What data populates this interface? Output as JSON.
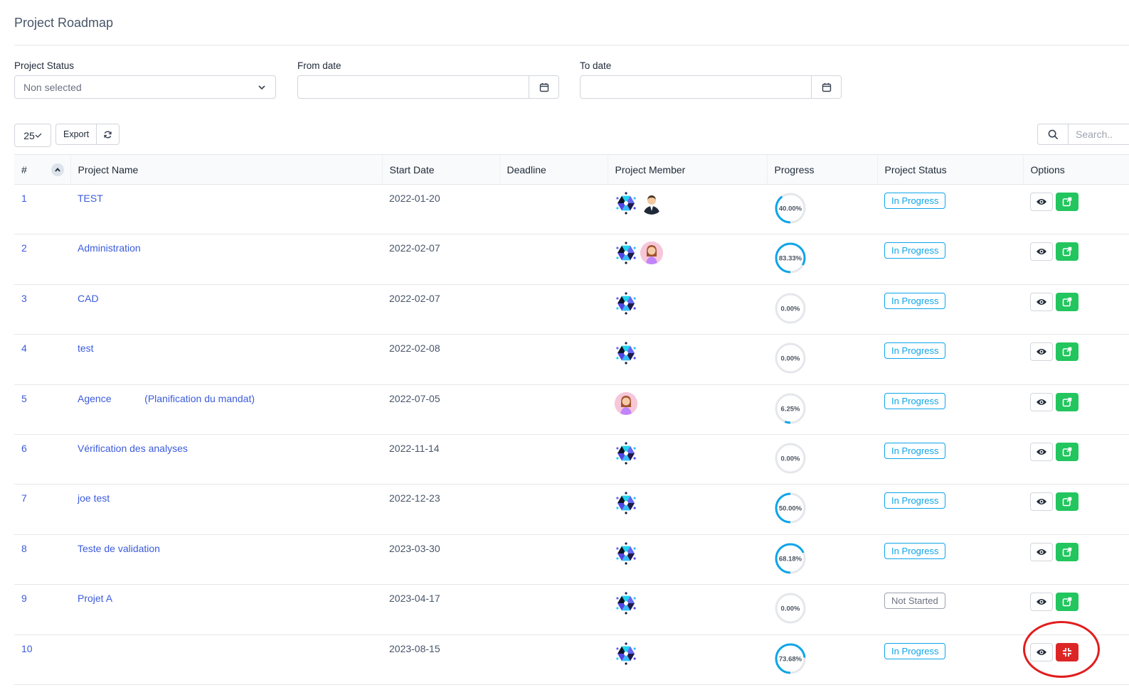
{
  "page": {
    "title": "Project Roadmap"
  },
  "filters": {
    "status_label": "Project Status",
    "status_placeholder": "Non selected",
    "from_label": "From date",
    "to_label": "To date"
  },
  "toolbar": {
    "page_length": "25",
    "export_label": "Export",
    "search_placeholder": "Search.."
  },
  "table": {
    "headers": [
      "#",
      "Project Name",
      "Start Date",
      "Deadline",
      "Project Member",
      "Progress",
      "Project Status",
      "Options"
    ],
    "rows": [
      {
        "num": "1",
        "name": "TEST",
        "start": "2022-01-20",
        "deadline": "",
        "members": [
          "logo",
          "man"
        ],
        "progress": 40.0,
        "progress_label": "40.00%",
        "status": "In Progress",
        "action": "edit"
      },
      {
        "num": "2",
        "name": "Administration",
        "start": "2022-02-07",
        "deadline": "",
        "members": [
          "logo",
          "woman"
        ],
        "progress": 83.33,
        "progress_label": "83.33%",
        "status": "In Progress",
        "action": "edit"
      },
      {
        "num": "3",
        "name": "CAD",
        "start": "2022-02-07",
        "deadline": "",
        "members": [
          "logo"
        ],
        "progress": 0,
        "progress_label": "0.00%",
        "status": "In Progress",
        "action": "edit"
      },
      {
        "num": "4",
        "name": "test",
        "start": "2022-02-08",
        "deadline": "",
        "members": [
          "logo"
        ],
        "progress": 0,
        "progress_label": "0.00%",
        "status": "In Progress",
        "action": "edit"
      },
      {
        "num": "5",
        "name": "Agence            (Planification du mandat)",
        "start": "2022-07-05",
        "deadline": "",
        "members": [
          "woman"
        ],
        "progress": 6.25,
        "progress_label": "6.25%",
        "status": "In Progress",
        "action": "edit"
      },
      {
        "num": "6",
        "name": "Vérification des analyses",
        "start": "2022-11-14",
        "deadline": "",
        "members": [
          "logo"
        ],
        "progress": 0,
        "progress_label": "0.00%",
        "status": "In Progress",
        "action": "edit"
      },
      {
        "num": "7",
        "name": "joe test",
        "start": "2022-12-23",
        "deadline": "",
        "members": [
          "logo"
        ],
        "progress": 50.0,
        "progress_label": "50.00%",
        "status": "In Progress",
        "action": "edit"
      },
      {
        "num": "8",
        "name": "Teste de validation",
        "start": "2023-03-30",
        "deadline": "",
        "members": [
          "logo"
        ],
        "progress": 68.18,
        "progress_label": "68.18%",
        "status": "In Progress",
        "action": "edit"
      },
      {
        "num": "9",
        "name": "Projet A",
        "start": "2023-04-17",
        "deadline": "",
        "members": [
          "logo"
        ],
        "progress": 0,
        "progress_label": "0.00%",
        "status": "Not Started",
        "action": "edit"
      },
      {
        "num": "10",
        "name": "",
        "start": "2023-08-15",
        "deadline": "",
        "members": [
          "logo"
        ],
        "progress": 73.68,
        "progress_label": "73.68%",
        "status": "In Progress",
        "action": "compress"
      }
    ]
  },
  "colors": {
    "link": "#3b5bdb",
    "status_in_progress": "#0ea5e9",
    "status_not_started": "#9ca3af",
    "progress_ring": "#0ea5e9",
    "edit_button": "#22c55e",
    "alt_button": "#dc2626",
    "annotation": "#e11d1d"
  },
  "icons": {
    "dropdown": "chevron-down-icon",
    "date_picker": "calendar-icon",
    "length_select": "check-icon",
    "reload": "refresh-icon",
    "search": "search-icon",
    "sort": "chevron-up-icon",
    "view": "eye-icon",
    "edit": "external-link-icon",
    "alt_action": "compress-icon"
  }
}
